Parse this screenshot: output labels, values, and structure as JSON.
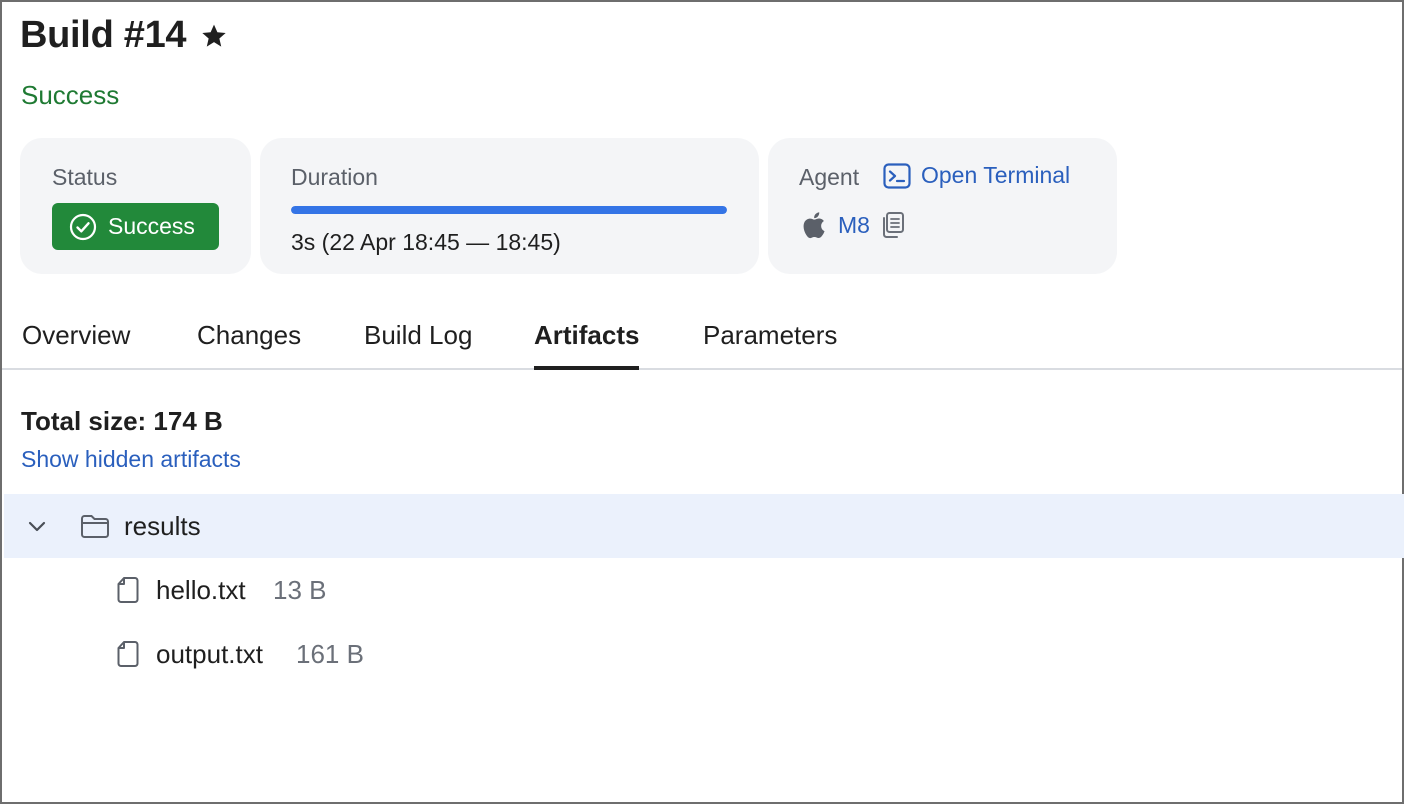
{
  "header": {
    "title": "Build #14",
    "status_text": "Success"
  },
  "cards": {
    "status": {
      "label": "Status",
      "badge": "Success"
    },
    "duration": {
      "label": "Duration",
      "progress": 1.0,
      "text": "3s (22 Apr 18:45 — 18:45)"
    },
    "agent": {
      "label": "Agent",
      "terminal_link": "Open Terminal",
      "name": "M8"
    }
  },
  "tabs": [
    {
      "label": "Overview",
      "active": false
    },
    {
      "label": "Changes",
      "active": false
    },
    {
      "label": "Build Log",
      "active": false
    },
    {
      "label": "Artifacts",
      "active": true
    },
    {
      "label": "Parameters",
      "active": false
    }
  ],
  "artifacts": {
    "total_size": "Total size: 174 B",
    "show_hidden": "Show hidden artifacts",
    "folder": {
      "name": "results",
      "expanded": true
    },
    "files": [
      {
        "name": "hello.txt",
        "size": "13 B"
      },
      {
        "name": "output.txt",
        "size": "161 B"
      }
    ]
  },
  "icons": {
    "star": "star-icon",
    "check": "check-circle-icon",
    "terminal": "terminal-icon",
    "apple": "apple-icon",
    "copy": "copy-icon",
    "chevron": "chevron-down-icon",
    "folder": "folder-icon",
    "file": "file-icon"
  },
  "colors": {
    "success_text": "#1f7a33",
    "success_badge": "#22893a",
    "link": "#2a5fbd",
    "progress": "#3474e6",
    "selected_row": "#ebf1fc"
  }
}
